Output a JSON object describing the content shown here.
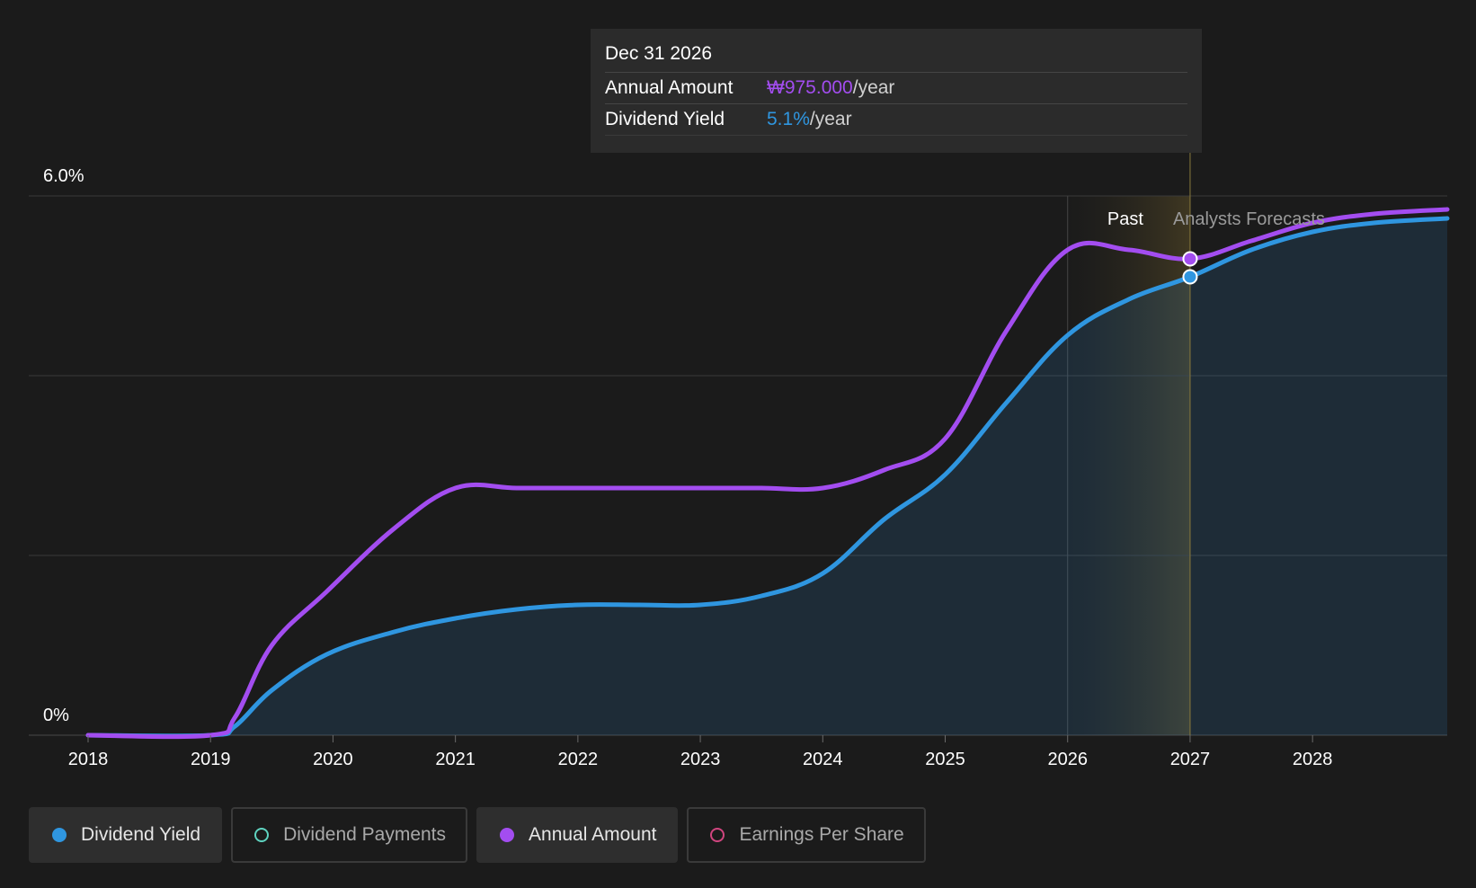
{
  "tooltip": {
    "date": "Dec 31 2026",
    "rows": [
      {
        "label": "Annual Amount",
        "value": "₩975.000",
        "unit": "/year",
        "color": "#a34df0"
      },
      {
        "label": "Dividend Yield",
        "value": "5.1%",
        "unit": "/year",
        "color": "#2f96e0"
      }
    ]
  },
  "regions": {
    "past_label": "Past",
    "forecast_label": "Analysts Forecasts"
  },
  "legend": [
    {
      "label": "Dividend Yield",
      "color": "#2f96e0",
      "filled": true,
      "active": true
    },
    {
      "label": "Dividend Payments",
      "color": "#5fd3c0",
      "filled": false,
      "active": false
    },
    {
      "label": "Annual Amount",
      "color": "#a34df0",
      "filled": true,
      "active": true
    },
    {
      "label": "Earnings Per Share",
      "color": "#d0457f",
      "filled": false,
      "active": false
    }
  ],
  "chart_data": {
    "type": "line",
    "y_tick_labels": [
      "6.0%",
      "0%"
    ],
    "ylim": [
      0,
      6.0
    ],
    "x_ticks": [
      2018,
      2019,
      2020,
      2021,
      2022,
      2023,
      2024,
      2025,
      2026,
      2027,
      2028
    ],
    "xlim": [
      2018,
      2029.1
    ],
    "grid": true,
    "forecast_start": 2026,
    "highlight_x": 2027,
    "series": [
      {
        "name": "Dividend Yield",
        "color": "#2f96e0",
        "area": true,
        "x": [
          2018,
          2019,
          2019.2,
          2019.5,
          2019.95,
          2020.5,
          2021,
          2021.5,
          2022,
          2022.5,
          2023,
          2023.5,
          2024,
          2024.5,
          2025,
          2025.5,
          2026,
          2026.5,
          2027,
          2027.5,
          2028,
          2028.5,
          2029.1
        ],
        "y": [
          0,
          0,
          0.1,
          0.5,
          0.9,
          1.15,
          1.3,
          1.4,
          1.45,
          1.45,
          1.45,
          1.55,
          1.8,
          2.4,
          2.9,
          3.7,
          4.45,
          4.85,
          5.1,
          5.4,
          5.6,
          5.7,
          5.75
        ]
      },
      {
        "name": "Annual Amount",
        "color": "#a34df0",
        "area": false,
        "x": [
          2018,
          2019,
          2019.2,
          2019.5,
          2019.95,
          2020.5,
          2021,
          2021.5,
          2022,
          2022.5,
          2023,
          2023.5,
          2024,
          2024.5,
          2025,
          2025.5,
          2026,
          2026.5,
          2027,
          2027.5,
          2028,
          2028.5,
          2029.1
        ],
        "y": [
          0,
          0,
          0.2,
          1.0,
          1.6,
          2.3,
          2.75,
          2.75,
          2.75,
          2.75,
          2.75,
          2.75,
          2.75,
          2.95,
          3.3,
          4.5,
          5.4,
          5.4,
          5.3,
          5.5,
          5.7,
          5.8,
          5.85
        ]
      }
    ]
  }
}
